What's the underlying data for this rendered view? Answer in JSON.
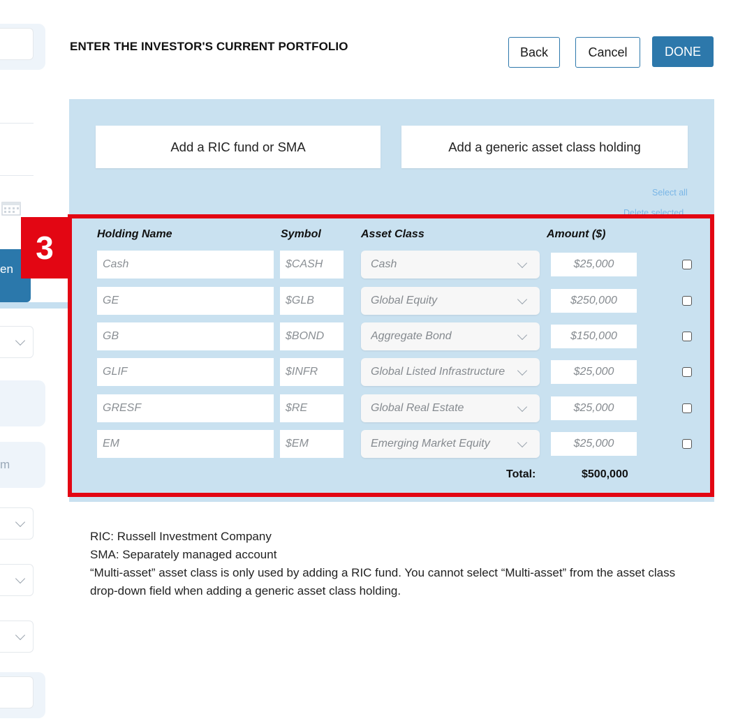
{
  "header": {
    "title": "ENTER THE INVESTOR'S CURRENT PORTFOLIO",
    "back_label": "Back",
    "cancel_label": "Cancel",
    "done_label": "DONE"
  },
  "add_buttons": {
    "ric_label": "Add a RIC fund or SMA",
    "generic_label": "Add a generic asset class holding"
  },
  "links": {
    "select_all": "Select all",
    "delete_selected": "Delete selected"
  },
  "step_marker": "3",
  "table": {
    "columns": [
      "Holding Name",
      "Symbol",
      "Asset Class",
      "Amount ($)"
    ],
    "rows": [
      {
        "name": "Cash",
        "symbol": "$CASH",
        "asset_class": "Cash",
        "amount": "$25,000"
      },
      {
        "name": "GE",
        "symbol": "$GLB",
        "asset_class": "Global Equity",
        "amount": "$250,000"
      },
      {
        "name": "GB",
        "symbol": "$BOND",
        "asset_class": "Aggregate Bond",
        "amount": "$150,000"
      },
      {
        "name": "GLIF",
        "symbol": "$INFR",
        "asset_class": "Global Listed Infrastructure",
        "amount": "$25,000"
      },
      {
        "name": "GRESF",
        "symbol": "$RE",
        "asset_class": "Global Real Estate",
        "amount": "$25,000"
      },
      {
        "name": "EM",
        "symbol": "$EM",
        "asset_class": "Emerging Market Equity",
        "amount": "$25,000"
      }
    ],
    "total_label": "Total:",
    "total_value": "$500,000"
  },
  "left_panel": {
    "button_fragment": "en",
    "field_fragment": "m"
  },
  "notes": [
    "RIC: Russell Investment Company",
    "SMA: Separately managed account",
    "“Multi-asset” asset class is only used by adding a RIC fund. You cannot select “Multi-asset” from the asset class drop-down field when adding a generic asset class holding."
  ],
  "colors": {
    "primary": "#2d78ab",
    "panel_bg": "#c9e1f0",
    "highlight": "#e30613",
    "link": "#7ab6e6"
  }
}
